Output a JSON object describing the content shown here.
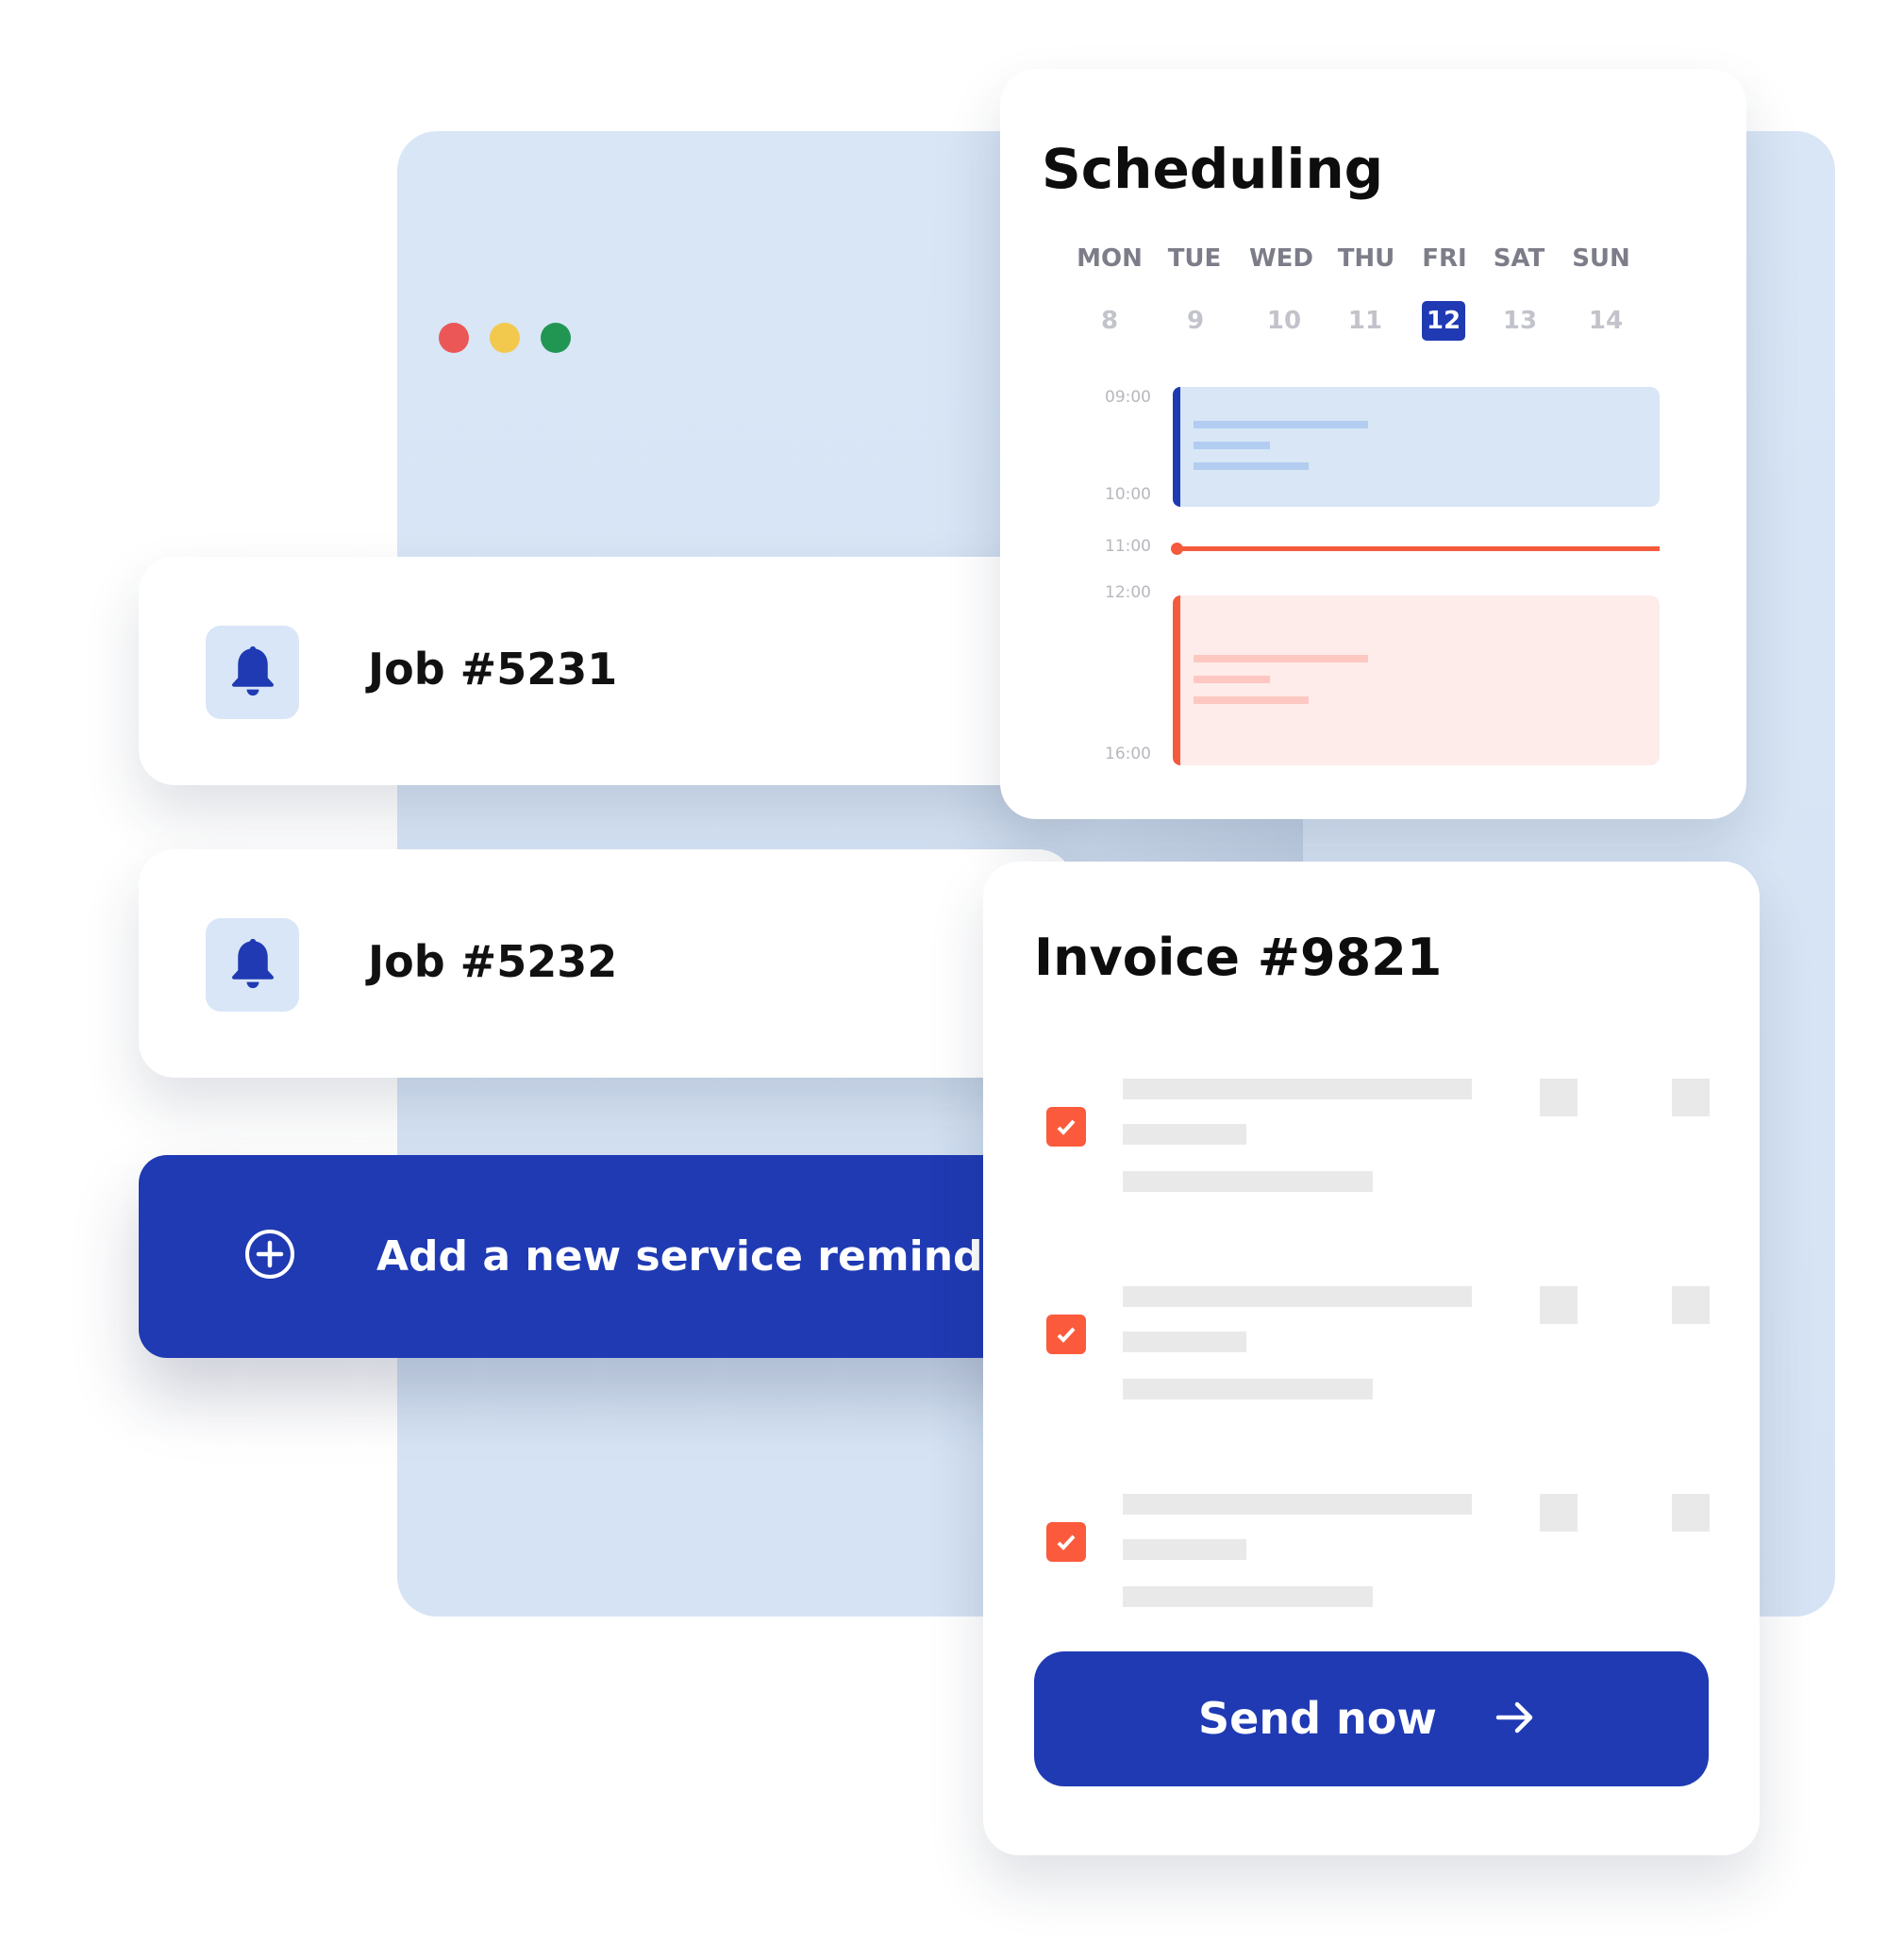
{
  "window": {
    "controls": [
      {
        "name": "close",
        "color": "#eb5757"
      },
      {
        "name": "minimize",
        "color": "#f2c94c"
      },
      {
        "name": "maximize",
        "color": "#219653"
      }
    ]
  },
  "jobs": [
    {
      "label": "Job #5231",
      "icon": "bell-icon"
    },
    {
      "label": "Job #5232",
      "icon": "bell-icon"
    }
  ],
  "add_reminder": {
    "label": "Add a new service reminder",
    "icon": "plus-circle-icon"
  },
  "scheduling": {
    "title": "Scheduling",
    "days": [
      {
        "dow": "MON",
        "date": "8"
      },
      {
        "dow": "TUE",
        "date": "9"
      },
      {
        "dow": "WED",
        "date": "10"
      },
      {
        "dow": "THU",
        "date": "11"
      },
      {
        "dow": "FRI",
        "date": "12",
        "selected": true
      },
      {
        "dow": "SAT",
        "date": "13"
      },
      {
        "dow": "SUN",
        "date": "14"
      }
    ],
    "times": [
      "09:00",
      "10:00",
      "11:00",
      "12:00",
      "16:00"
    ],
    "events": [
      {
        "start": "09:00",
        "end": "10:00",
        "color": "#1f3ab3",
        "bg": "#d8e6f6"
      },
      {
        "start": "12:00",
        "end": "16:00",
        "color": "#f55a3c",
        "bg": "#fdecea"
      }
    ],
    "current_time": "11:00",
    "accent": "#1f3ab3",
    "now_color": "#f55a3c"
  },
  "invoice": {
    "title": "Invoice #9821",
    "items": [
      {
        "checked": true
      },
      {
        "checked": true
      },
      {
        "checked": true
      }
    ],
    "send_label": "Send now",
    "send_icon": "arrow-right-icon"
  }
}
